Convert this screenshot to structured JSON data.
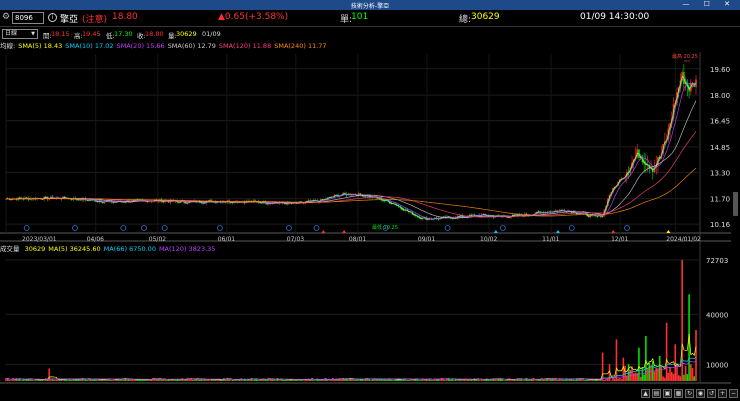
{
  "window": {
    "title": "技術分析-擎亞",
    "controls": "— ☐ ✕"
  },
  "quote": {
    "code": "8096",
    "name": "擎亞",
    "tag": "(注意)",
    "price": "18.80",
    "change": "▲0.65(+3.58%)",
    "single_label": "單:",
    "single_value": "101",
    "total_label": "總:",
    "total_value": "30629",
    "datetime": "01/09 14:30:00"
  },
  "stats": {
    "period": "日線",
    "open_label": "開:",
    "open": "18.15",
    "high_label": "高:",
    "high": "19.45",
    "low_label": "低:",
    "low": "17.30",
    "close_label": "收:",
    "close": "18.80",
    "vol_label": "量:",
    "vol": "30629",
    "date": "01/09"
  },
  "sma": {
    "label": "均線:",
    "items": [
      {
        "text": "SMA(5) 18.43",
        "color": "#ffff00"
      },
      {
        "text": "SMA(10) 17.02",
        "color": "#00d0ff"
      },
      {
        "text": "SMA(20) 15.66",
        "color": "#c040ff"
      },
      {
        "text": "SMA(60) 12.79",
        "color": "#c8c8c8"
      },
      {
        "text": "SMA(120) 11.88",
        "color": "#ff4080"
      },
      {
        "text": "SMA(240) 11.77",
        "color": "#ff8c00"
      }
    ]
  },
  "volume": {
    "label": "成交量",
    "value": "30629",
    "items": [
      {
        "text": "MA(5) 36245.60",
        "color": "#ffff00"
      },
      {
        "text": "MA(66) 6750.00",
        "color": "#00d0ff"
      },
      {
        "text": "MA(120) 3823.35",
        "color": "#c040ff"
      }
    ]
  },
  "chart_data": [
    {
      "type": "candlestick",
      "x_tick_labels": [
        "2023/03/01",
        "04/06",
        "05/02",
        "06/01",
        "07/03",
        "08/01",
        "09/01",
        "10/02",
        "11/01",
        "12/01",
        "2024/01/02"
      ],
      "y_tick_labels": [
        "19.60",
        "18.00",
        "16.45",
        "14.85",
        "13.30",
        "11.70",
        "10.16"
      ],
      "ylim": [
        9.8,
        20.5
      ],
      "annotations": [
        "最高 20.25",
        "最低 10.25"
      ],
      "series": [
        {
          "name": "SMA(5)",
          "last": 18.43
        },
        {
          "name": "SMA(10)",
          "last": 17.02
        },
        {
          "name": "SMA(20)",
          "last": 15.66
        },
        {
          "name": "SMA(60)",
          "last": 12.79
        },
        {
          "name": "SMA(120)",
          "last": 11.88
        },
        {
          "name": "SMA(240)",
          "last": 11.77
        }
      ],
      "close_path": [
        [
          0,
          11.7
        ],
        [
          8,
          11.75
        ],
        [
          12,
          11.6
        ],
        [
          15,
          11.5
        ],
        [
          20,
          11.6
        ],
        [
          25,
          11.5
        ],
        [
          30,
          11.55
        ],
        [
          35,
          11.5
        ],
        [
          40,
          11.4
        ],
        [
          44,
          11.6
        ],
        [
          46,
          11.9
        ],
        [
          48,
          12.0
        ],
        [
          50,
          11.9
        ],
        [
          52,
          11.7
        ],
        [
          54,
          11.4
        ],
        [
          56,
          10.9
        ],
        [
          58,
          10.5
        ],
        [
          60,
          10.5
        ],
        [
          63,
          10.6
        ],
        [
          66,
          10.7
        ],
        [
          69,
          10.6
        ],
        [
          72,
          10.7
        ],
        [
          75,
          10.9
        ],
        [
          78,
          11.0
        ],
        [
          80,
          10.8
        ],
        [
          82,
          10.6
        ],
        [
          83,
          10.7
        ],
        [
          84,
          12.0
        ],
        [
          86,
          13.2
        ],
        [
          88,
          14.5
        ],
        [
          89,
          14.0
        ],
        [
          90,
          13.6
        ],
        [
          91,
          14.2
        ],
        [
          92,
          15.5
        ],
        [
          93,
          17.5
        ],
        [
          94,
          19.2
        ],
        [
          95,
          18.4
        ],
        [
          96,
          18.8
        ]
      ]
    },
    {
      "type": "bar",
      "title": "成交量",
      "y_tick_labels": [
        "72703",
        "40000",
        "10000"
      ],
      "ylim": [
        0,
        75000
      ],
      "spikes": [
        [
          6,
          7500
        ],
        [
          83,
          17000
        ],
        [
          84,
          10000
        ],
        [
          85,
          25000
        ],
        [
          86,
          14000
        ],
        [
          88,
          20000
        ],
        [
          89,
          27000
        ],
        [
          90,
          12000
        ],
        [
          91,
          15000
        ],
        [
          92,
          35000
        ],
        [
          93,
          22000
        ],
        [
          94,
          72703
        ],
        [
          95,
          52000
        ],
        [
          96,
          30629
        ]
      ]
    }
  ]
}
